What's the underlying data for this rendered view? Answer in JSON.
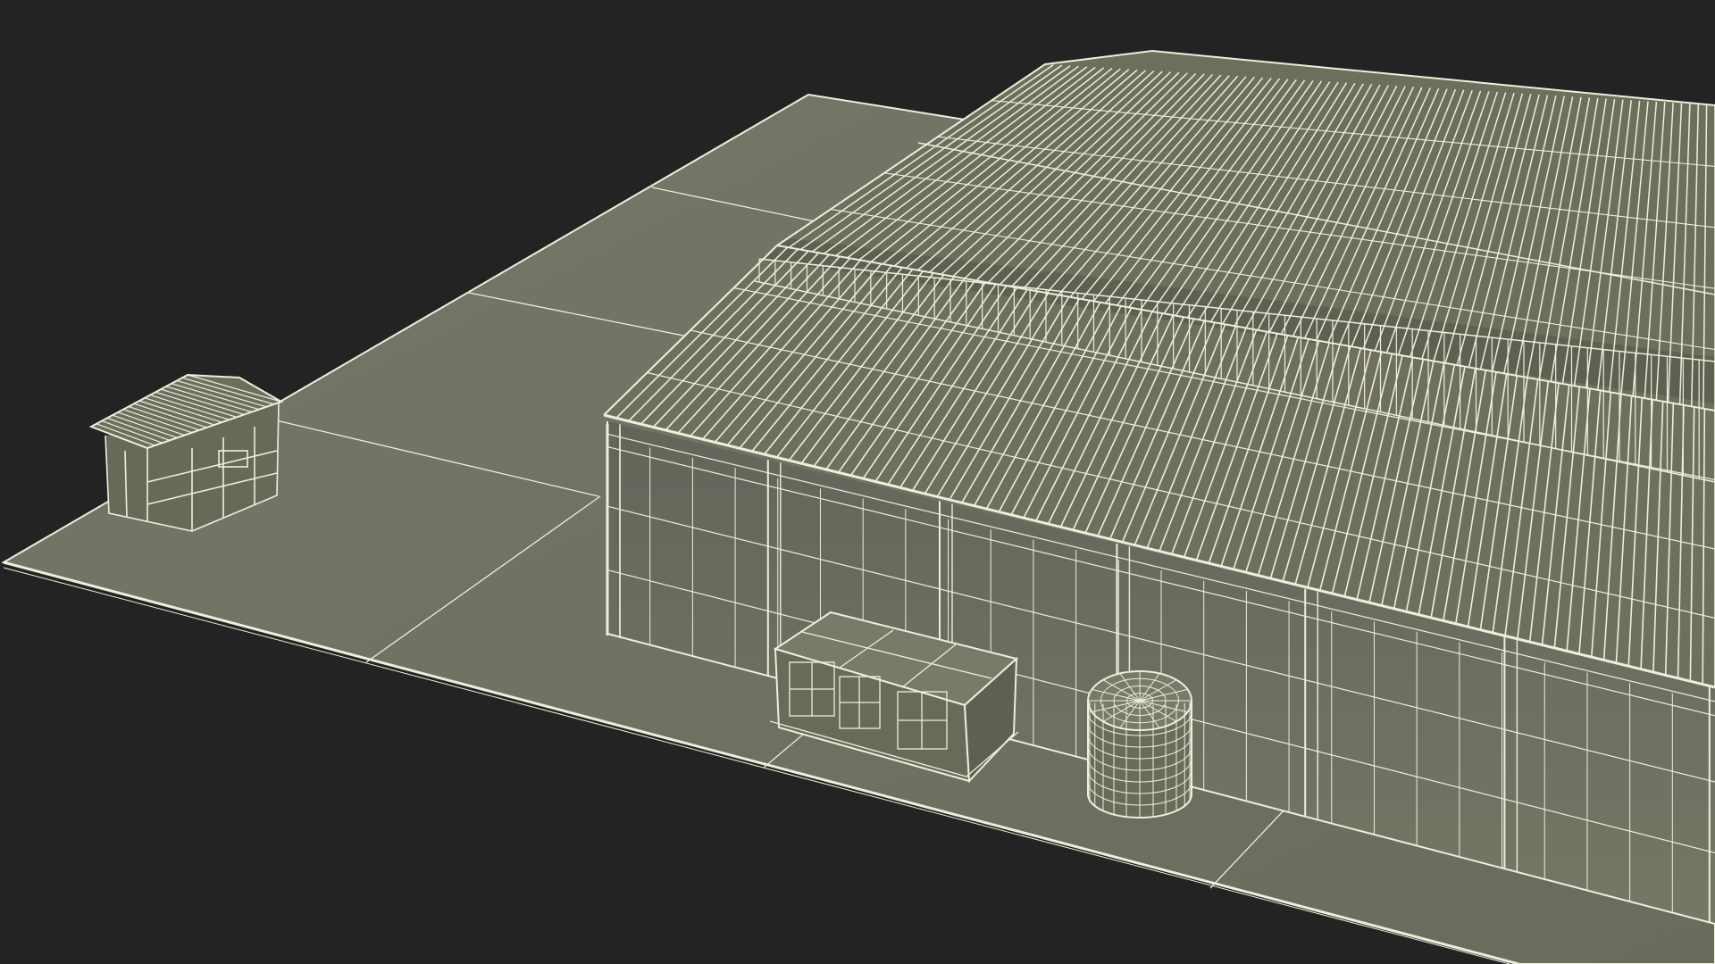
{
  "scene": {
    "background_color": "#232323",
    "ground_color": "#70705F",
    "wall_color": "#6C6C5C",
    "roof_color": "#6F6F5E",
    "wire_color": "#EEEEDC"
  },
  "objects": [
    {
      "id": "ground-slab"
    },
    {
      "id": "warehouse"
    },
    {
      "id": "small-shed"
    },
    {
      "id": "utility-box"
    },
    {
      "id": "water-tank"
    }
  ]
}
